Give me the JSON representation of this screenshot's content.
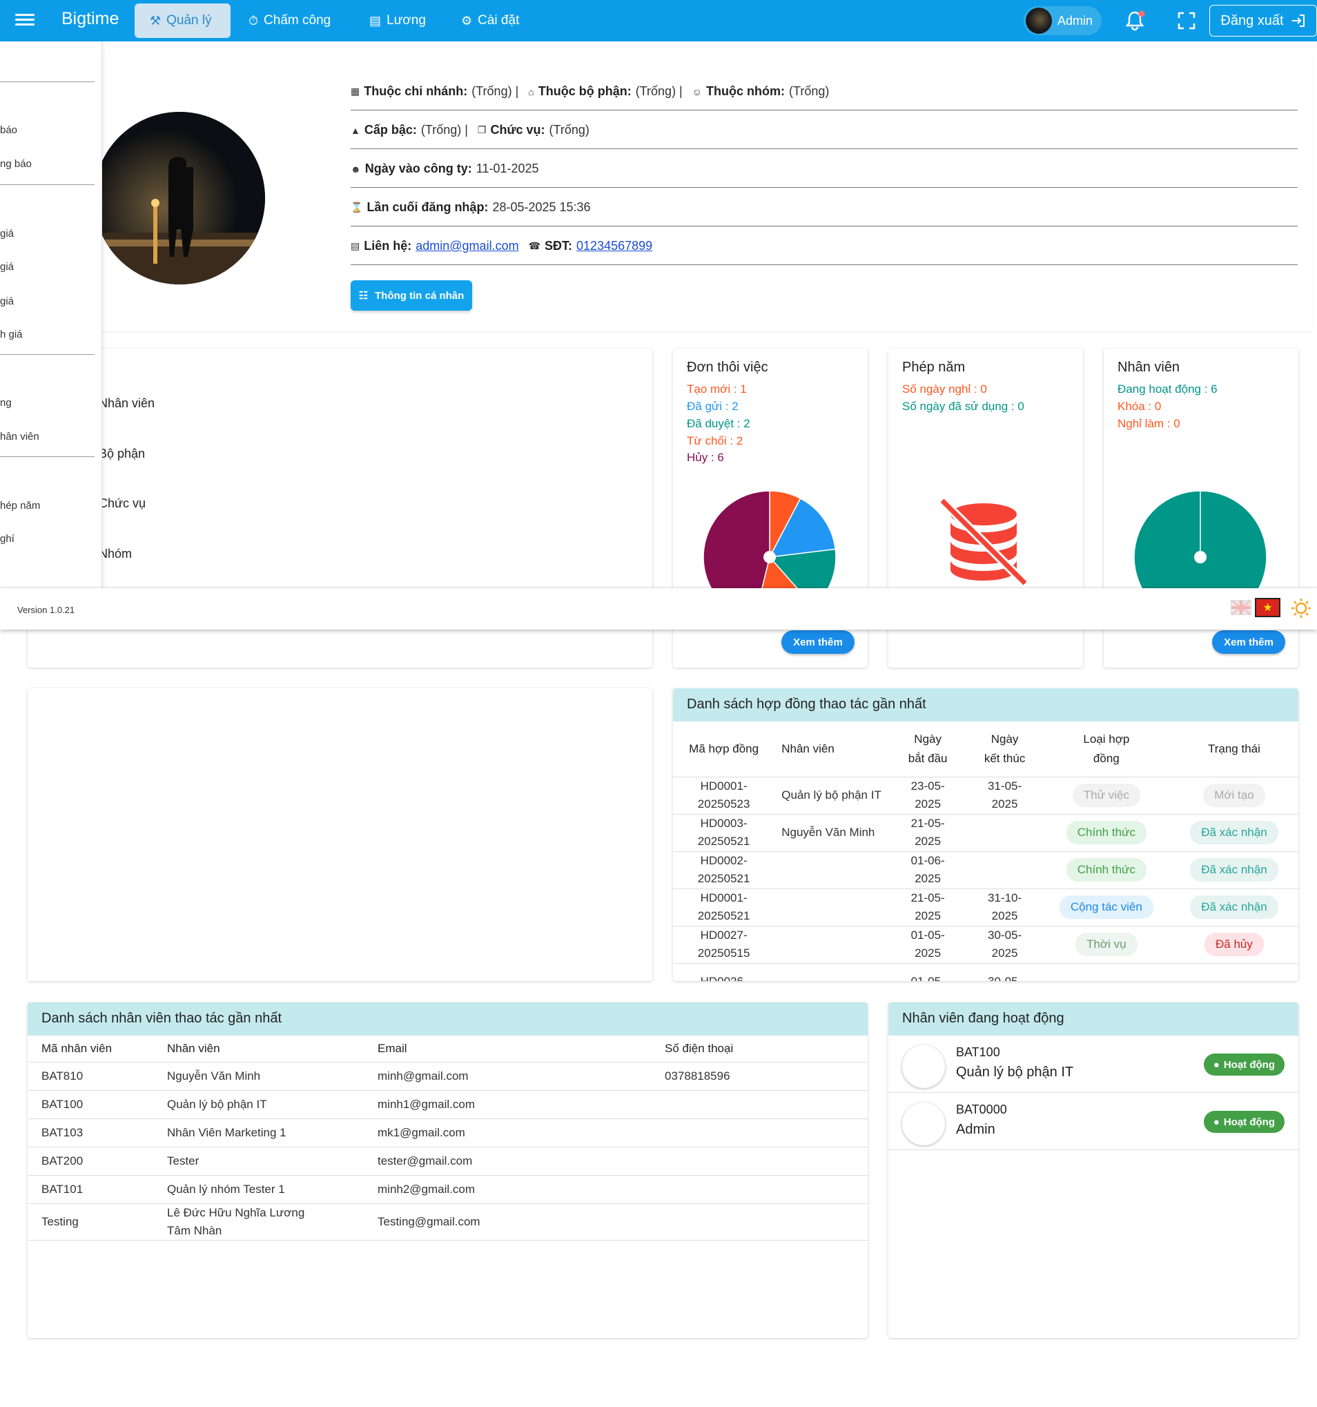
{
  "app": {
    "brand": "Bigtime"
  },
  "nav": {
    "quanly": "Quản lý",
    "chamcong": "Chấm công",
    "luong": "Lương",
    "caidat": "Cài đặt"
  },
  "header": {
    "user_name": "Admin",
    "logout": "Đăng xuất"
  },
  "sidebar": {
    "items": [
      "báo",
      "ng báo",
      "giá",
      "giá",
      "giá",
      "h giá",
      "ng",
      "hân viên",
      "hép năm",
      "ghí"
    ]
  },
  "profile": {
    "branch_label": "Thuộc chi nhánh:",
    "branch_value": "(Trống) |",
    "dept_label": "Thuộc bộ phận:",
    "dept_value": "(Trống) |",
    "group_label": "Thuộc nhóm:",
    "group_value": "(Trống)",
    "level_label": "Cấp bậc:",
    "level_value": "(Trống) |",
    "position_label": "Chức vụ:",
    "position_value": "(Trống)",
    "join_label": "Ngày vào công ty:",
    "join_value": "11-01-2025",
    "lastlogin_label": "Lần cuối đăng nhập:",
    "lastlogin_value": "28-05-2025 15:36",
    "contact_label": "Liên hệ:",
    "contact_email": "admin@gmail.com",
    "phone_label": "SĐT:",
    "phone_value": "01234567899",
    "button": "Thông tin cá nhân"
  },
  "mid_labels": [
    "Nhân viên",
    "Bộ phận",
    "Chức vụ",
    "Nhóm"
  ],
  "resign": {
    "title": "Đơn thôi việc",
    "lines": [
      "Tạo mới : 1",
      "Đã gửi : 2",
      "Đã duyệt : 2",
      "Từ chối : 2",
      "Hủy : 6"
    ],
    "button": "Xem thêm",
    "chart_data": {
      "type": "pie",
      "categories": [
        "Tạo mới",
        "Đã gửi",
        "Đã duyệt",
        "Từ chối",
        "Hủy"
      ],
      "values": [
        1,
        2,
        2,
        2,
        6
      ],
      "colors": [
        "#ff5722",
        "#2196f3",
        "#009688",
        "#ff5722",
        "#880e4f"
      ]
    }
  },
  "leave": {
    "title": "Phép năm",
    "lines": [
      "Số ngày nghỉ : 0",
      "Số ngày đã sử dụng : 0"
    ]
  },
  "staff": {
    "title": "Nhân viên",
    "lines": [
      "Đang hoạt động : 6",
      "Khóa : 0",
      "Nghỉ làm : 0"
    ],
    "button": "Xem thêm",
    "chart_data": {
      "type": "pie",
      "categories": [
        "Đang hoạt động",
        "Khóa",
        "Nghỉ làm"
      ],
      "values": [
        6,
        0,
        0
      ],
      "colors": [
        "#009688",
        "#ff5722",
        "#ff5722"
      ]
    }
  },
  "footer": {
    "version": "Version 1.0.21"
  },
  "contracts": {
    "title": "Danh sách hợp đồng thao tác gần nhất",
    "headers": [
      "Mã hợp đồng",
      "Nhân viên",
      "Ngày bắt đầu",
      "Ngày kết thúc",
      "Loại hợp đồng",
      "Trạng thái"
    ],
    "rows": [
      {
        "code": "HD0001-20250523",
        "employee": "Quản lý bộ phận IT",
        "start": "23-05-2025",
        "end": "31-05-2025",
        "type": "Thử việc",
        "status": "Mới tạo"
      },
      {
        "code": "HD0003-20250521",
        "employee": "Nguyễn Văn Minh",
        "start": "21-05-2025",
        "end": "",
        "type": "Chính thức",
        "status": "Đã xác nhận"
      },
      {
        "code": "HD0002-20250521",
        "employee": "",
        "start": "01-06-2025",
        "end": "",
        "type": "Chính thức",
        "status": "Đã xác nhận"
      },
      {
        "code": "HD0001-20250521",
        "employee": "",
        "start": "21-05-2025",
        "end": "31-10-2025",
        "type": "Cộng tác viên",
        "status": "Đã xác nhận"
      },
      {
        "code": "HD0027-20250515",
        "employee": "",
        "start": "01-05-2025",
        "end": "30-05-2025",
        "type": "Thời vụ",
        "status": "Đã hủy"
      },
      {
        "code": "HD0026-",
        "employee": "",
        "start": "01-05-",
        "end": "30-05-",
        "type": "",
        "status": ""
      }
    ]
  },
  "employees": {
    "title": "Danh sách nhân viên thao tác gần nhất",
    "headers": [
      "Mã nhân viên",
      "Nhân viên",
      "Email",
      "Số điện thoại"
    ],
    "rows": [
      {
        "code": "BAT810",
        "name": "Nguyễn Văn Minh",
        "email": "minh@gmail.com",
        "phone": "0378818596"
      },
      {
        "code": "BAT100",
        "name": "Quản lý bộ phận IT",
        "email": "minh1@gmail.com",
        "phone": ""
      },
      {
        "code": "BAT103",
        "name": "Nhân Viên Marketing 1",
        "email": "mk1@gmail.com",
        "phone": ""
      },
      {
        "code": "BAT200",
        "name": "Tester",
        "email": "tester@gmail.com",
        "phone": ""
      },
      {
        "code": "BAT101",
        "name": "Quản lý nhóm Tester 1",
        "email": "minh2@gmail.com",
        "phone": ""
      },
      {
        "code": "Testing",
        "name": "Lê Đức Hữu Nghĩa Lương Tâm Nhàn",
        "email": "Testing@gmail.com",
        "phone": ""
      }
    ]
  },
  "active": {
    "title": "Nhân viên đang hoạt động",
    "rows": [
      {
        "code": "BAT100",
        "name": "Quản lý bộ phận IT",
        "badge": "Hoạt động"
      },
      {
        "code": "BAT0000",
        "name": "Admin",
        "badge": "Hoạt động"
      }
    ]
  }
}
